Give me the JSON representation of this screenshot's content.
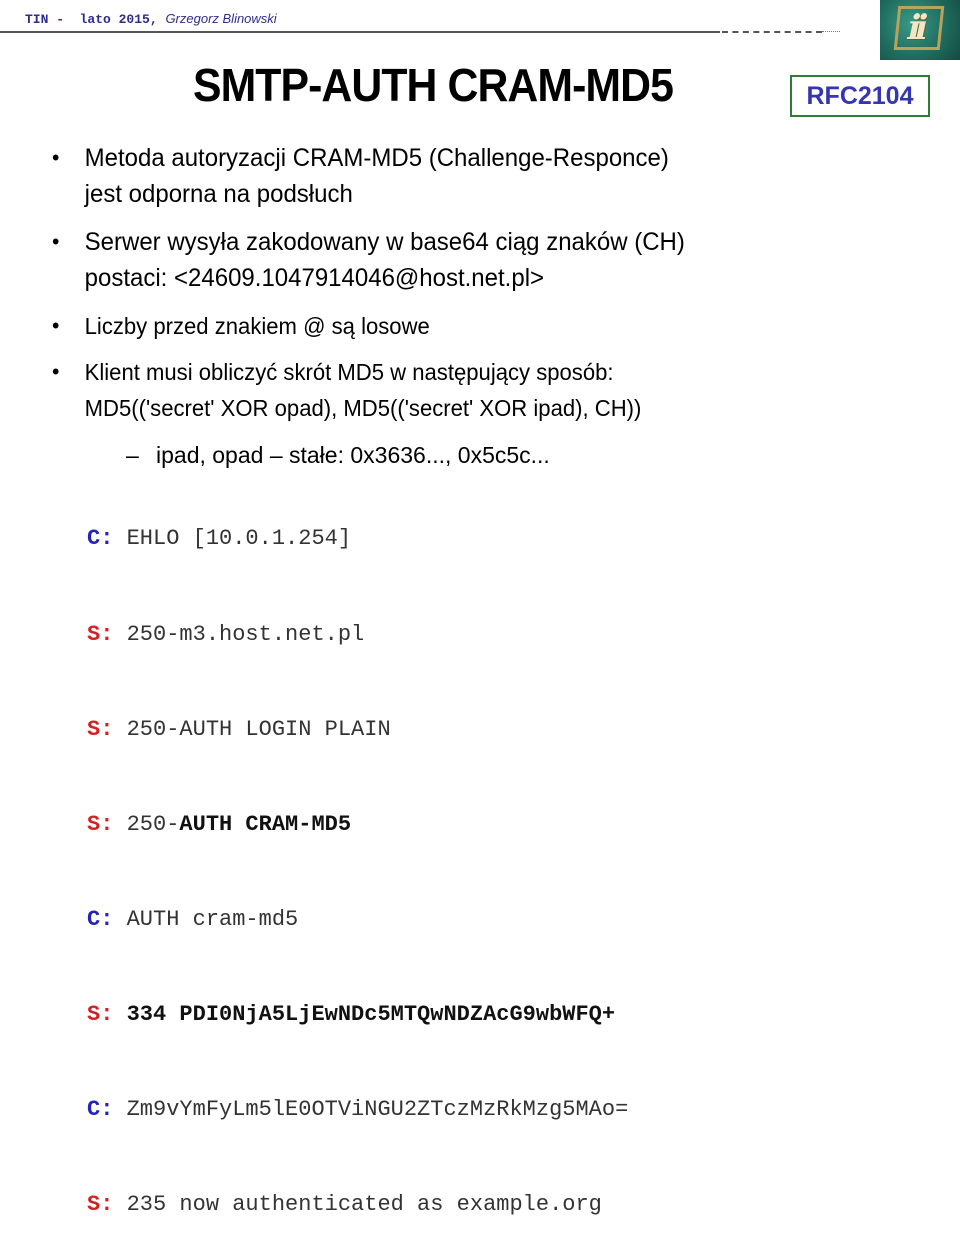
{
  "header": {
    "course": "TIN -  lato 2015, ",
    "author": "Grzegorz Blinowski",
    "logo_icon": "ii-logo-icon"
  },
  "slide": {
    "title": "SMTP-AUTH CRAM-MD5",
    "rfc_badge": "RFC2104",
    "bullets": [
      {
        "lines": [
          "Metoda autoryzacji CRAM-MD5 (Challenge-Responce)",
          "jest odporna na podsłuch"
        ]
      },
      {
        "lines": [
          "Serwer wysyła zakodowany w base64 ciąg znaków (CH)",
          "postaci: <24609.1047914046@host.net.pl>"
        ]
      },
      {
        "lines": [
          "Liczby przed znakiem @ są losowe"
        ]
      },
      {
        "lines": [
          "Klient musi obliczyć skrót MD5 w następujący sposób:",
          "MD5(('secret' XOR opad), MD5(('secret' XOR ipad), CH))"
        ]
      }
    ],
    "sub_bullet": {
      "marker": "–",
      "text": "ipad, opad – stałe: 0x3636..., 0x5c5c..."
    },
    "session": [
      {
        "who": "C:",
        "role": "client",
        "text": "EHLO [10.0.1.254]",
        "bold_text": ""
      },
      {
        "who": "S:",
        "role": "server",
        "text": "250-m3.host.net.pl",
        "bold_text": ""
      },
      {
        "who": "S:",
        "role": "server",
        "text": "250-AUTH LOGIN PLAIN",
        "bold_text": ""
      },
      {
        "who": "S:",
        "role": "server",
        "text": "250-",
        "bold_text": "AUTH CRAM-MD5"
      },
      {
        "who": "C:",
        "role": "client",
        "text": "AUTH cram-md5",
        "bold_text": ""
      },
      {
        "who": "S:",
        "role": "server",
        "text": "",
        "bold_text": "334 PDI0NjA5LjEwNDc5MTQwNDZAcG9wbWFQ+"
      },
      {
        "who": "C:",
        "role": "client",
        "text": "Zm9vYmFyLm5lE0OTViNGU2ZTczMzRkMzg5MAo=",
        "bold_text": ""
      },
      {
        "who": "S:",
        "role": "server",
        "text": "235 now authenticated as example.org",
        "bold_text": ""
      }
    ]
  },
  "colors": {
    "header_text": "#2e2e8a",
    "rfc_text": "#3535b0",
    "rfc_border": "#2e7d32",
    "client_label": "#2424b8",
    "server_label": "#d42020"
  }
}
